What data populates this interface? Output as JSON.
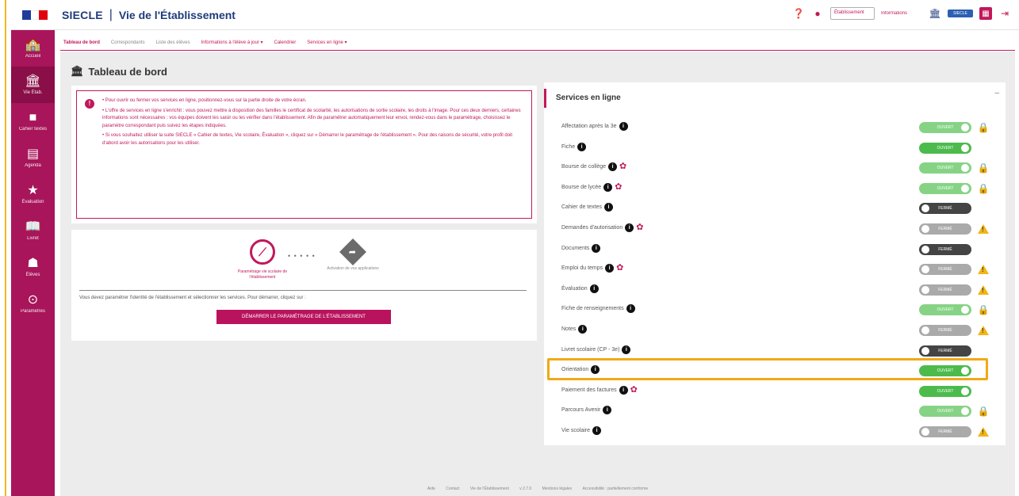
{
  "header": {
    "flag_colors": [
      "#1f3b9c",
      "#ffffff",
      "#e1000f"
    ],
    "app_name": "SIECLE",
    "separator": "|",
    "module_title": "Vie de l'Établissement",
    "select_value": "Établissement",
    "info_label": "Informations",
    "badge_label": "SIECLE",
    "icons": [
      "help-icon",
      "alert-icon",
      "school-icon",
      "profile-icon",
      "logout-icon"
    ]
  },
  "sidebar": {
    "items": [
      {
        "label": "Accueil",
        "icon": "home-icon"
      },
      {
        "label": "Vie Étab.",
        "icon": "building-icon"
      },
      {
        "label": "Cahier textes",
        "icon": "book-icon"
      },
      {
        "label": "Agenda",
        "icon": "calendar-icon"
      },
      {
        "label": "Évaluation",
        "icon": "star-icon"
      },
      {
        "label": "Livret",
        "icon": "open-book-icon"
      },
      {
        "label": "Élèves",
        "icon": "person-icon"
      },
      {
        "label": "Paramètres",
        "icon": "settings-icon"
      }
    ]
  },
  "tabs": [
    {
      "label": "Tableau de bord"
    },
    {
      "label": "Correspondants"
    },
    {
      "label": "Liste des élèves"
    },
    {
      "label": "Informations à l'élève à jour ▾"
    },
    {
      "label": "Calendrier"
    },
    {
      "label": "Services en ligne ▾"
    }
  ],
  "page": {
    "title": "Tableau de bord"
  },
  "info": {
    "badge": "!",
    "paragraphs": [
      "• Pour ouvrir ou fermer vos services en ligne, positionnez-vous sur la partie droite de votre écran.",
      "• L'offre de services en ligne s'enrichit : vous pouvez mettre à disposition des familles le certificat de scolarité, les autorisations de sortie scolaire, les droits à l'image. Pour ces deux derniers, certaines informations sont nécessaires : vos équipes doivent les saisir ou les vérifier dans l'établissement. Afin de paramétrer automatiquement leur envoi, rendez-vous dans le paramétrage, choisissez le paramètre correspondant puis suivez les étapes indiquées.",
      "• Si vous souhaitez utiliser la suite SIECLE « Cahier de textes, Vie scolaire, Évaluation », cliquez sur « Démarrer le paramétrage de l'établissement ». Pour des raisons de sécurité, votre profil doit d'abord avoir les autorisations pour les utiliser."
    ]
  },
  "setup": {
    "step1_label": "Paramétrage vie scolaire de l'établissement",
    "step2_label": "Activation de vos applications",
    "dots": "• • • • •",
    "description": "Vous devez paramétrer l'identité de l'établissement et sélectionner les services. Pour démarrer, cliquez sur :",
    "button_label": "DÉMARRER LE PARAMÉTRAGE DE L'ÉTABLISSEMENT"
  },
  "services": {
    "title": "Services en ligne",
    "collapse": "–",
    "items": [
      {
        "label": "Affectation après la 3e",
        "info": true,
        "gear": false,
        "state": "OUVERT",
        "style": "lgreen",
        "suffix": "lock"
      },
      {
        "label": "Fiche",
        "info": true,
        "gear": false,
        "state": "OUVERT",
        "style": "green",
        "suffix": ""
      },
      {
        "label": "Bourse de collège",
        "info": true,
        "gear": true,
        "state": "OUVERT",
        "style": "lgreen",
        "suffix": "lock"
      },
      {
        "label": "Bourse de lycée",
        "info": true,
        "gear": true,
        "state": "OUVERT",
        "style": "lgreen",
        "suffix": "lock"
      },
      {
        "label": "Cahier de textes",
        "info": true,
        "gear": false,
        "state": "FERMÉ",
        "style": "dark",
        "suffix": ""
      },
      {
        "label": "Demandes d'autorisation",
        "info": true,
        "gear": true,
        "state": "FERMÉ",
        "style": "grey",
        "suffix": "warn"
      },
      {
        "label": "Documents",
        "info": true,
        "gear": false,
        "state": "FERMÉ",
        "style": "dark",
        "suffix": ""
      },
      {
        "label": "Emploi du temps",
        "info": true,
        "gear": true,
        "state": "FERMÉ",
        "style": "grey",
        "suffix": "warn"
      },
      {
        "label": "Évaluation",
        "info": true,
        "gear": false,
        "state": "FERMÉ",
        "style": "grey",
        "suffix": "warn"
      },
      {
        "label": "Fiche de renseignements",
        "info": true,
        "gear": false,
        "state": "OUVERT",
        "style": "lgreen",
        "suffix": "lock"
      },
      {
        "label": "Notes",
        "info": true,
        "gear": false,
        "state": "FERMÉ",
        "style": "grey",
        "suffix": "warn"
      },
      {
        "label": "Livret scolaire (CP - 3e)",
        "info": true,
        "gear": false,
        "state": "FERMÉ",
        "style": "dark",
        "suffix": ""
      },
      {
        "label": "Orientation",
        "info": true,
        "gear": false,
        "state": "OUVERT",
        "style": "green",
        "suffix": ""
      },
      {
        "label": "Paiement des factures",
        "info": true,
        "gear": true,
        "state": "OUVERT",
        "style": "green",
        "suffix": ""
      },
      {
        "label": "Parcours Avenir",
        "info": true,
        "gear": false,
        "state": "OUVERT",
        "style": "lgreen",
        "suffix": "lock"
      },
      {
        "label": "Vie scolaire",
        "info": true,
        "gear": false,
        "state": "FERMÉ",
        "style": "grey",
        "suffix": "warn"
      }
    ]
  },
  "footer": {
    "links": [
      "Aide",
      "Contact",
      "Vie de l'Établissement",
      "v 2.7.0",
      "Mentions légales",
      "Accessibilité : partiellement conforme"
    ]
  },
  "colors": {
    "brand": "#b8135c",
    "sidebar": "#a8155a",
    "highlight": "#f1a917",
    "toggle_on": "#4cbb4c",
    "toggle_off": "#aaaaaa"
  }
}
